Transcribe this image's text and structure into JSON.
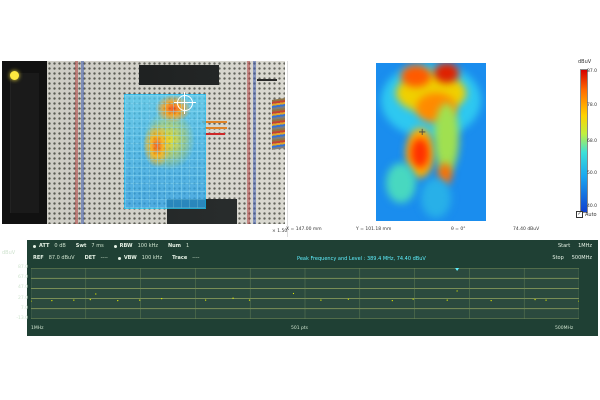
{
  "scan_panel": {
    "scale_unit": "dBuV",
    "scale_ticks": [
      "87.0",
      "78.0",
      "68.0",
      "50.0",
      "40.0"
    ],
    "auto_label": "Auto",
    "auto_checked": "✓",
    "x_readout": "X = 147.00 mm",
    "y_readout": "Y = 101.18 mm",
    "angle_readout": "θ = 0°",
    "level_readout": "74.40 dBuV",
    "cursor_symbol": "+",
    "colors": {
      "hot": "#d60000",
      "warm": "#ffd200",
      "cool": "#1aa6f0",
      "cold": "#1040d0"
    }
  },
  "photo_panel": {
    "scale_readout": "× 1.50"
  },
  "spectrum": {
    "att_label": "ATT",
    "att_value": "0 dB",
    "swt_label": "Swt",
    "swt_value": "7 ms",
    "rbw_label": "RBW",
    "rbw_value": "100 kHz",
    "num_label": "Num",
    "num_value": "1",
    "ref_label": "REF",
    "ref_value": "87.0 dBuV",
    "det_label": "DET",
    "det_value": "----",
    "vbw_label": "VBW",
    "vbw_value": "100 kHz",
    "trace_label": "Trace",
    "trace_value": "----",
    "unit": "dBuV",
    "peak_text": "Peak Frequency and Level : 389.4 MHz, 74.40 dBuV",
    "start_label": "Start",
    "start_value": "1MHz",
    "stop_label": "Stop",
    "stop_value": "500MHz",
    "y_ticks": [
      "87.0",
      "67.0",
      "47.0",
      "27.0",
      "7.0",
      "-13.0"
    ],
    "x_start": "1MHz",
    "x_mid": "501 pts",
    "x_end": "500MHz",
    "colors": {
      "background": "#1f4034",
      "trace": "#e8f000",
      "marker": "#5ff0ff"
    }
  },
  "chart_data": {
    "type": "line",
    "xlabel": "",
    "ylabel": "dBuV",
    "ylim": [
      -13,
      87
    ],
    "xlim": [
      1,
      500
    ],
    "grid": true,
    "x": [
      1,
      20,
      40,
      55,
      60,
      80,
      100,
      120,
      160,
      185,
      200,
      240,
      265,
      290,
      330,
      349,
      380,
      389,
      420,
      460,
      470,
      500
    ],
    "series": [
      {
        "values": [
          22,
          23,
          24,
          25,
          36,
          23,
          24,
          27,
          24,
          28,
          24,
          37,
          24,
          26,
          23,
          26,
          24,
          42,
          23,
          25,
          24,
          22
        ]
      }
    ]
  }
}
